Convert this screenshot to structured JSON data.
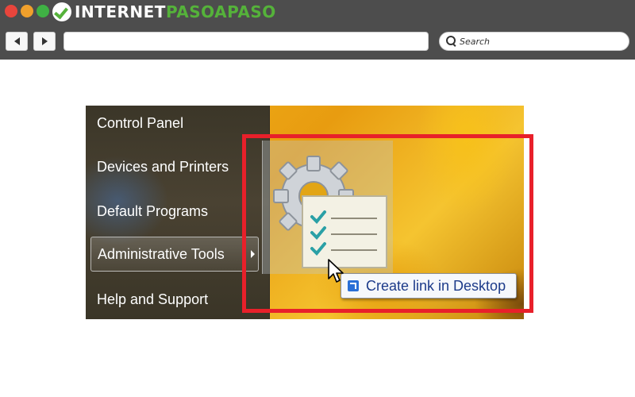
{
  "browser": {
    "logo_part1": "INTERNET",
    "logo_part2": "PASOAPASO",
    "url_value": "",
    "search_placeholder": "Search"
  },
  "start_menu": {
    "items": [
      {
        "label": "Control Panel"
      },
      {
        "label": "Devices and Printers"
      },
      {
        "label": "Default Programs"
      },
      {
        "label": "Administrative Tools",
        "selected": true
      },
      {
        "label": "Help and Support"
      }
    ]
  },
  "tooltip": {
    "text": "Create link in Desktop"
  },
  "colors": {
    "highlight": "#e8202a",
    "chrome": "#4d4d4d",
    "logo_accent": "#55b23a"
  },
  "icons": [
    "search-icon",
    "back-arrow-icon",
    "forward-arrow-icon",
    "administrative-tools-icon",
    "shortcut-link-icon",
    "mouse-cursor-icon"
  ]
}
